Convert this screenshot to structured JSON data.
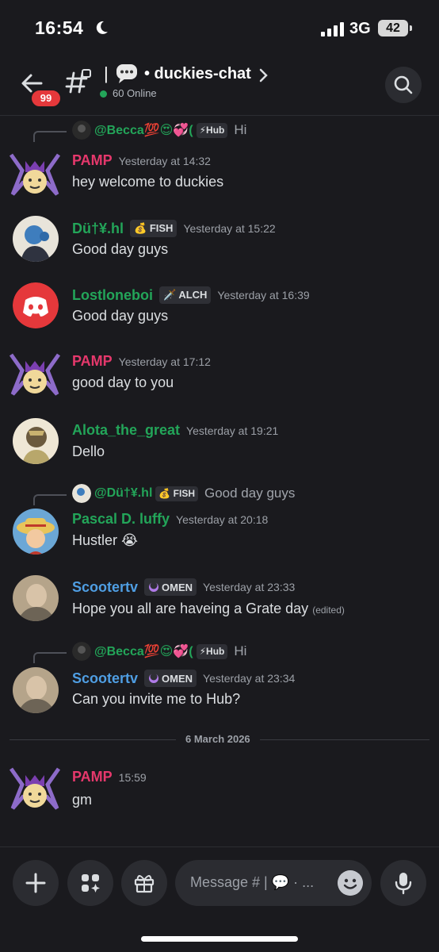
{
  "status": {
    "time": "16:54",
    "network": "3G",
    "battery": "42"
  },
  "header": {
    "badge": "99",
    "channel_prefix": "|",
    "channel_name": "• duckies-chat",
    "online": "60 Online"
  },
  "messages": [
    {
      "reply": {
        "name": "@Becca💯😍💞(",
        "tag": "⚡Hub",
        "text": "Hi"
      },
      "name": "PAMP",
      "name_color": "#e6386c",
      "time": "Yesterday at 14:32",
      "text": "hey welcome to duckies"
    },
    {
      "name": "Dü†¥.hl",
      "name_color": "#23a559",
      "tag": "💰 FISH",
      "time": "Yesterday at 15:22",
      "text": "Good day guys"
    },
    {
      "name": "Lostloneboi",
      "name_color": "#23a559",
      "tag": "🗡️ ALCH",
      "time": "Yesterday at 16:39",
      "text": "Good day guys"
    },
    {
      "name": "PAMP",
      "name_color": "#e6386c",
      "time": "Yesterday at 17:12",
      "text": "good day to you"
    },
    {
      "name": "Alota_the_great",
      "name_color": "#23a559",
      "time": "Yesterday at 19:21",
      "text": "Dello"
    },
    {
      "reply": {
        "name": "@Dü†¥.hl",
        "tag": "💰 FISH",
        "text": "Good day guys"
      },
      "name": "Pascal D. luffy",
      "name_color": "#23a559",
      "time": "Yesterday at 20:18",
      "text": "Hustler 😭"
    },
    {
      "name": "Scootertv",
      "name_color": "#4f9ee3",
      "tag": "OMEN",
      "time": "Yesterday at 23:33",
      "text": "Hope you all are haveing a Grate day",
      "edited": "(edited)"
    },
    {
      "reply": {
        "name": "@Becca💯😍💞(",
        "tag": "⚡Hub",
        "text": "Hi"
      },
      "name": "Scootertv",
      "name_color": "#4f9ee3",
      "tag": "OMEN",
      "time": "Yesterday at 23:34",
      "text": "Can you invite me to Hub?"
    },
    {
      "name": "PAMP",
      "name_color": "#e6386c",
      "time": "15:59",
      "text": "gm"
    }
  ],
  "date_divider": "6 March 2026",
  "composer": {
    "placeholder": "Message # | 💬 · ..."
  },
  "icons": {
    "header": [
      "back-arrow-icon",
      "thread-icon",
      "chat-bubble-icon",
      "chevron-right-icon",
      "search-icon"
    ],
    "composer": [
      "plus-icon",
      "apps-icon",
      "gift-icon",
      "emoji-icon",
      "microphone-icon"
    ]
  }
}
